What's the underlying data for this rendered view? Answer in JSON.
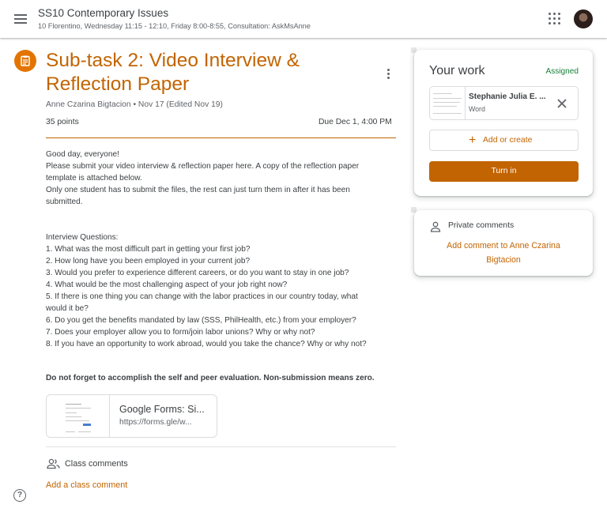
{
  "header": {
    "class_title": "SS10 Contemporary Issues",
    "class_subtitle": "10 Florentino, Wednesday 11:15 - 12:10, Friday 8:00-8:55, Consultation: AskMsAnne"
  },
  "assignment": {
    "title": "Sub-task 2: Video Interview & Reflection Paper",
    "meta": "Anne Czarina Bigtacion • Nov 17 (Edited Nov 19)",
    "points": "35 points",
    "due": "Due Dec 1, 4:00 PM",
    "description_lines": [
      "Good day, everyone!",
      "Please submit your video interview & reflection paper here. A copy of the reflection paper",
      "template is attached below.",
      "Only one student has to submit the files, the rest can just turn them in after it has been",
      "submitted."
    ],
    "questions_lines": [
      "Interview Questions:",
      "1. What was the most difficult part in getting your first job?",
      "2. How long have you been employed in your current job?",
      "3. Would you prefer to experience different careers, or do you want to stay in one job?",
      "4. What would be the most challenging aspect of your job right now?",
      "5. If there is one thing you can change with the labor practices in our country today, what",
      "would it be?",
      "6. Do you get the benefits mandated by law (SSS, PhilHealth, etc.) from your employer?",
      "7. Does your employer allow you to form/join labor unions? Why or why not?",
      "8. If you have an opportunity to work abroad, would you take the chance? Why or why not?"
    ],
    "bold_note": "Do not forget to accomplish the self and peer evaluation. Non-submission means zero.",
    "attachment": {
      "title": "Google Forms: Si...",
      "url": "https://forms.gle/w..."
    }
  },
  "class_comments": {
    "label": "Class comments",
    "add_label": "Add a class comment"
  },
  "your_work": {
    "title": "Your work",
    "status": "Assigned",
    "file_name": "Stephanie Julia E. ...",
    "file_type": "Word",
    "add_label": "Add or create",
    "turn_in_label": "Turn in"
  },
  "private_comments": {
    "label": "Private comments",
    "add_label": "Add comment to Anne Czarina Bigtacion"
  },
  "help": {
    "label": "?"
  },
  "colors": {
    "accent": "#c26401",
    "icon_bg": "#e37400",
    "assigned_status": "#188038"
  },
  "icons": {
    "menu": "menu-icon",
    "apps": "apps-grid-icon",
    "assignment": "assignment-icon",
    "more": "more-vert-icon",
    "people": "people-icon",
    "person": "person-icon",
    "close": "close-icon",
    "add": "plus-icon",
    "help": "help-icon"
  }
}
